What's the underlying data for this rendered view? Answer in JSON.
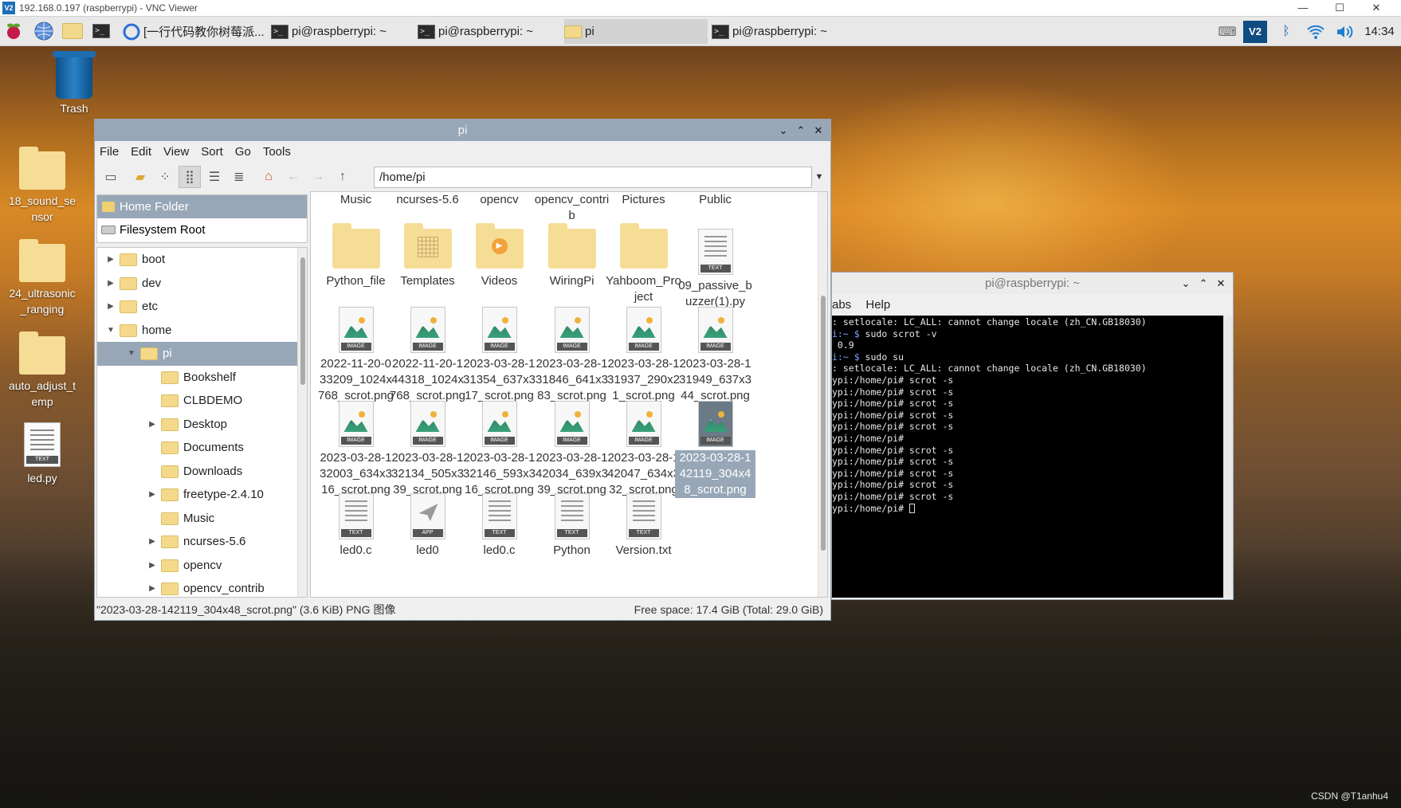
{
  "vnc": {
    "title": "192.168.0.197 (raspberrypi) - VNC Viewer",
    "logo": "V2",
    "controls": [
      "—",
      "☐",
      "✕"
    ]
  },
  "panel": {
    "tasks": [
      {
        "label": "[一行代码教你树莓派...",
        "icon": "browser-icon"
      },
      {
        "label": "pi@raspberrypi: ~",
        "icon": "terminal-icon"
      },
      {
        "label": "pi@raspberrypi: ~",
        "icon": "terminal-icon"
      },
      {
        "label": "pi",
        "icon": "folder-icon"
      },
      {
        "label": "pi@raspberrypi: ~",
        "icon": "terminal-icon"
      }
    ],
    "clock": "14:34",
    "vnc_badge": "V2"
  },
  "desktop": {
    "icons": [
      {
        "label": "Trash",
        "type": "trash"
      },
      {
        "label": "18_sound_sensor",
        "type": "folder"
      },
      {
        "label": "24_ultrasonic_ranging",
        "type": "folder"
      },
      {
        "label": "auto_adjust_temp",
        "type": "folder"
      },
      {
        "label": "led.py",
        "type": "text"
      }
    ]
  },
  "file_manager": {
    "title": "pi",
    "menu": [
      "File",
      "Edit",
      "View",
      "Sort",
      "Go",
      "Tools"
    ],
    "path": "/home/pi",
    "places": [
      "Home Folder",
      "Filesystem Root"
    ],
    "tree": [
      {
        "label": "boot",
        "expander": "▶"
      },
      {
        "label": "dev",
        "expander": "▶"
      },
      {
        "label": "etc",
        "expander": "▶"
      },
      {
        "label": "home",
        "expander": "▼"
      },
      {
        "label": "pi",
        "expander": "▼"
      },
      {
        "label": "Bookshelf",
        "expander": ""
      },
      {
        "label": "CLBDEMO",
        "expander": ""
      },
      {
        "label": "Desktop",
        "expander": "▶"
      },
      {
        "label": "Documents",
        "expander": ""
      },
      {
        "label": "Downloads",
        "expander": ""
      },
      {
        "label": "freetype-2.4.10",
        "expander": "▶"
      },
      {
        "label": "Music",
        "expander": ""
      },
      {
        "label": "ncurses-5.6",
        "expander": "▶"
      },
      {
        "label": "opencv",
        "expander": "▶"
      },
      {
        "label": "opencv_contrib",
        "expander": "▶"
      }
    ],
    "items": [
      {
        "name": "Music",
        "kind": "none"
      },
      {
        "name": "ncurses-5.6",
        "kind": "none"
      },
      {
        "name": "opencv",
        "kind": "none"
      },
      {
        "name": "opencv_contrib",
        "kind": "none"
      },
      {
        "name": "Pictures",
        "kind": "none"
      },
      {
        "name": "Public",
        "kind": "none"
      },
      {
        "name": "Python_file",
        "kind": "folder"
      },
      {
        "name": "Templates",
        "kind": "folder-templates"
      },
      {
        "name": "Videos",
        "kind": "folder-videos"
      },
      {
        "name": "WiringPi",
        "kind": "folder"
      },
      {
        "name": "Yahboom_Project",
        "kind": "folder"
      },
      {
        "name": "09_passive_buzzer(1).py",
        "kind": "text"
      },
      {
        "name": "2022-11-20-033209_1024x768_scrot.png",
        "kind": "image"
      },
      {
        "name": "2022-11-20-144318_1024x768_scrot.png",
        "kind": "image"
      },
      {
        "name": "2023-03-28-131354_637x317_scrot.png",
        "kind": "image"
      },
      {
        "name": "2023-03-28-131846_641x383_scrot.png",
        "kind": "image"
      },
      {
        "name": "2023-03-28-131937_290x21_scrot.png",
        "kind": "image"
      },
      {
        "name": "2023-03-28-131949_637x344_scrot.png",
        "kind": "image"
      },
      {
        "name": "2023-03-28-132003_634x316_scrot.png",
        "kind": "image"
      },
      {
        "name": "2023-03-28-132134_505x339_scrot.png",
        "kind": "image"
      },
      {
        "name": "2023-03-28-132146_593x316_scrot.png",
        "kind": "image"
      },
      {
        "name": "2023-03-28-142034_639x339_scrot.png",
        "kind": "image"
      },
      {
        "name": "2023-03-28-142047_634x332_scrot.png",
        "kind": "image"
      },
      {
        "name": "2023-03-28-142119_304x48_scrot.png",
        "kind": "image",
        "selected": true
      },
      {
        "name": "led0.c",
        "kind": "text"
      },
      {
        "name": "led0",
        "kind": "app"
      },
      {
        "name": "led0.c",
        "kind": "text"
      },
      {
        "name": "Python",
        "kind": "text"
      },
      {
        "name": "Version.txt",
        "kind": "text"
      }
    ],
    "status_left": "\"2023-03-28-142119_304x48_scrot.png\" (3.6 KiB) PNG 图像",
    "status_right": "Free space: 17.4 GiB (Total: 29.0 GiB)"
  },
  "terminal": {
    "title": "pi@raspberrypi: ~",
    "menu": [
      "abs",
      "Help"
    ],
    "lines": [
      {
        "p": "",
        "t": ": setlocale: LC_ALL: cannot change locale (zh_CN.GB18030)"
      },
      {
        "p": "i:~ $",
        "t": " sudo scrot -v"
      },
      {
        "p": "",
        "t": " 0.9"
      },
      {
        "p": "i:~ $",
        "t": " sudo su"
      },
      {
        "p": "",
        "t": ": setlocale: LC_ALL: cannot change locale (zh_CN.GB18030)"
      },
      {
        "p": "",
        "t": "ypi:/home/pi# scrot -s"
      },
      {
        "p": "",
        "t": "ypi:/home/pi# scrot -s"
      },
      {
        "p": "",
        "t": "ypi:/home/pi# scrot -s"
      },
      {
        "p": "",
        "t": "ypi:/home/pi# scrot -s"
      },
      {
        "p": "",
        "t": "ypi:/home/pi# scrot -s"
      },
      {
        "p": "",
        "t": "ypi:/home/pi#"
      },
      {
        "p": "",
        "t": "ypi:/home/pi# scrot -s"
      },
      {
        "p": "",
        "t": "ypi:/home/pi# scrot -s"
      },
      {
        "p": "",
        "t": "ypi:/home/pi# scrot -s"
      },
      {
        "p": "",
        "t": "ypi:/home/pi# scrot -s"
      },
      {
        "p": "",
        "t": "ypi:/home/pi# scrot -s"
      },
      {
        "p": "",
        "t": "ypi:/home/pi# "
      }
    ]
  },
  "watermark": "CSDN @T1anhu4"
}
